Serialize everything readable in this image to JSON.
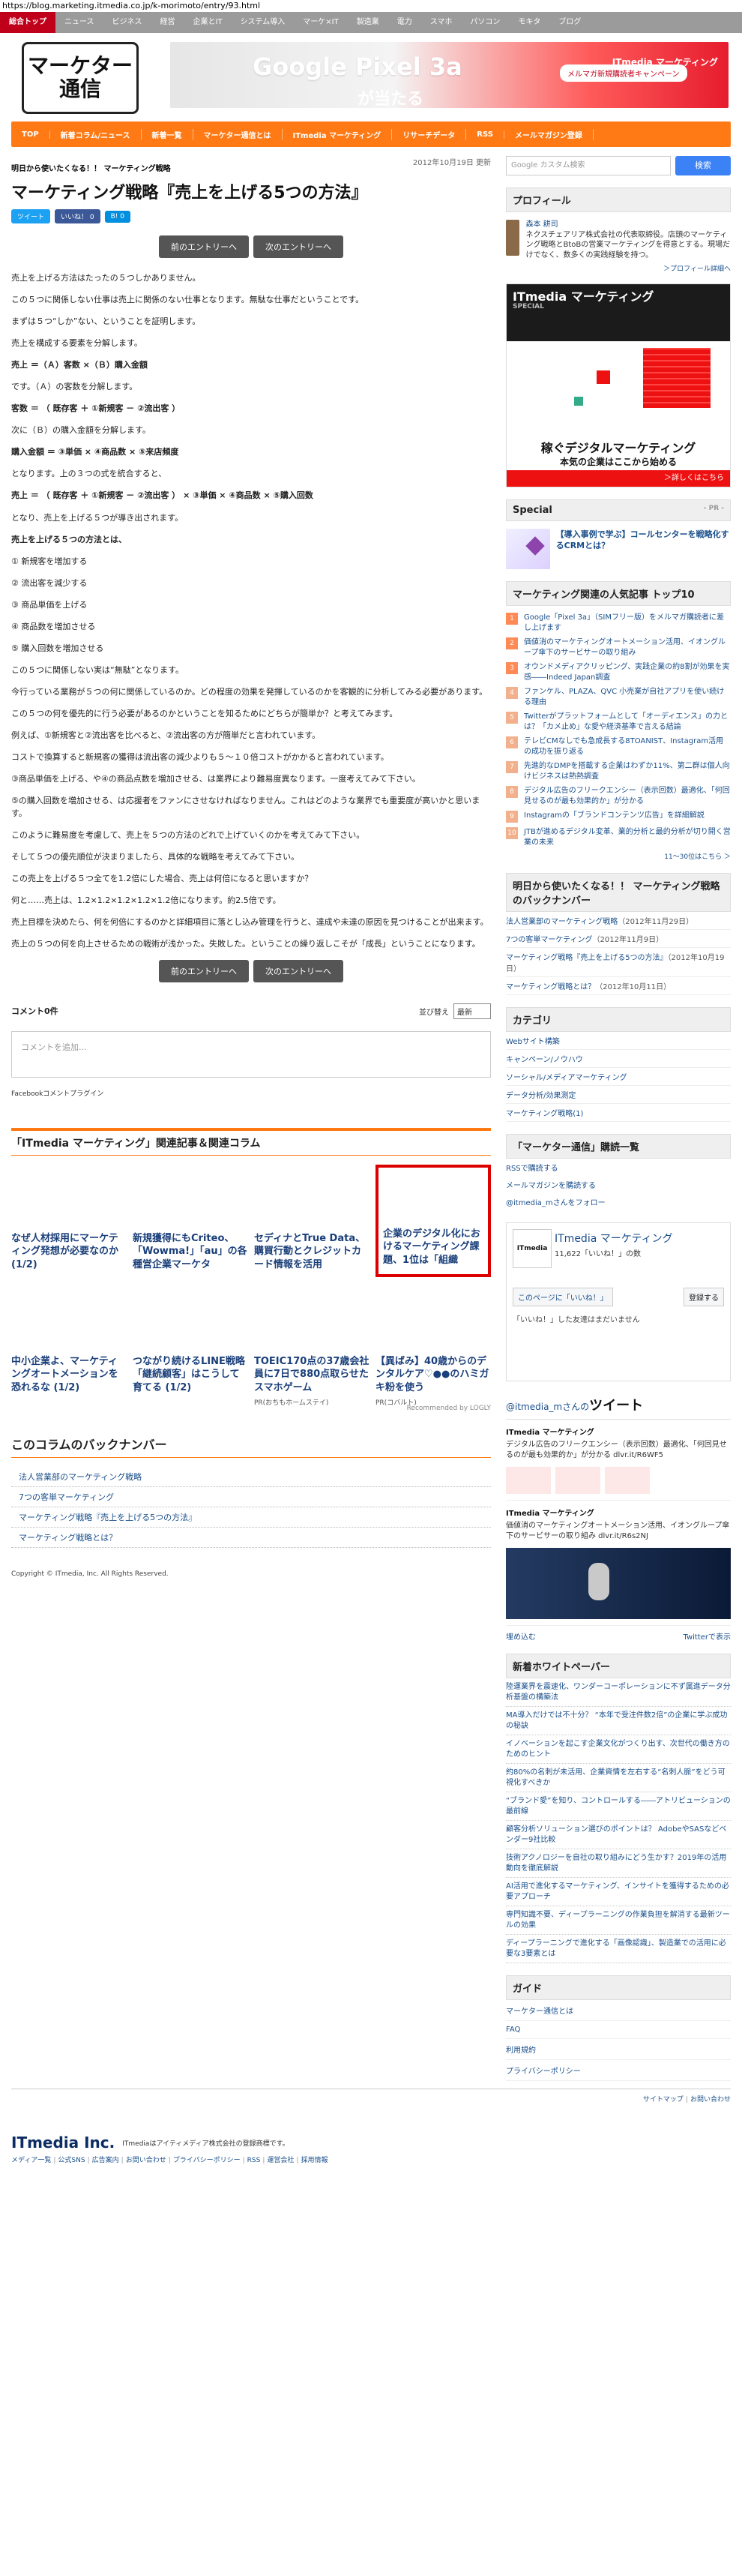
{
  "browser": {
    "url": "https://blog.marketing.itmedia.co.jp/k-morimoto/entry/93.html"
  },
  "topnav": [
    "総合トップ",
    "ニュース",
    "ビジネス",
    "経営",
    "企業とIT",
    "システム導入",
    "マーケ×IT",
    "製造業",
    "電力",
    "スマホ",
    "パソコン",
    "モキタ",
    "ブログ"
  ],
  "header": {
    "logo": "マーケター通信",
    "banner_title": "Google Pixel 3a",
    "banner_sub": "が当たる",
    "banner_pill": "メルマガ新規購読者キャンペーン",
    "banner_brand": "ITmedia マーケティング"
  },
  "orange_nav": [
    "TOP",
    "新着コラム/ニュース",
    "新着一覧",
    "マーケター通信とは",
    "ITmedia マーケティング",
    "リサーチデータ",
    "RSS",
    "メールマガジン登録"
  ],
  "article": {
    "kicker": "明日から使いたくなる！！ マーケティング戦略",
    "date": "2012年10月19日 更新",
    "title": "マーケティング戦略『売上を上げる5つの方法』",
    "tweet": "ツイート",
    "like": "いいね！ 0",
    "hatena": "B! 0",
    "prev": "前のエントリーへ",
    "next": "次のエントリーへ",
    "paragraphs": [
      {
        "text": "売上を上げる方法はたったの５つしかありません。",
        "bold": false
      },
      {
        "text": "この５つに関係しない仕事は売上に関係のない仕事となります。無駄な仕事だということです。",
        "bold": false
      },
      {
        "text": "まずは５つ“しか”ない、ということを証明します。",
        "bold": false
      },
      {
        "text": "売上を構成する要素を分解します。",
        "bold": false
      },
      {
        "text": "売上 ＝（Ａ）客数 ×（Ｂ）購入金額",
        "bold": true
      },
      {
        "text": "です。（Ａ）の客数を分解します。",
        "bold": false
      },
      {
        "text": "客数 ＝ （ 既存客 ＋ ①新規客 － ②流出客 ）",
        "bold": true
      },
      {
        "text": "次に（Ｂ）の購入金額を分解します。",
        "bold": false
      },
      {
        "text": "購入金額 ＝ ③単価 × ④商品数 × ⑤来店頻度",
        "bold": true
      },
      {
        "text": "となります。上の３つの式を統合すると、",
        "bold": false
      },
      {
        "text": "売上 ＝ （ 既存客 ＋ ①新規客 － ②流出客 ） × ③単価 × ④商品数 × ⑤購入回数",
        "bold": true
      },
      {
        "text": "となり、売上を上げる５つが導き出されます。",
        "bold": false
      },
      {
        "text": "売上を上げる５つの方法とは、",
        "bold": true
      },
      {
        "text": "① 新規客を増加する",
        "bold": false
      },
      {
        "text": "② 流出客を減少する",
        "bold": false
      },
      {
        "text": "③ 商品単価を上げる",
        "bold": false
      },
      {
        "text": "④ 商品数を増加させる",
        "bold": false
      },
      {
        "text": "⑤ 購入回数を増加させる",
        "bold": false
      },
      {
        "text": "この５つに関係しない実は“無駄”となります。",
        "bold": false
      },
      {
        "text": "今行っている業務が５つの何に関係しているのか。どの程度の効果を発揮しているのかを客観的に分析してみる必要があります。",
        "bold": false
      },
      {
        "text": "この５つの何を優先的に行う必要があるのかということを知るためにどちらが簡単か？と考えてみます。",
        "bold": false
      },
      {
        "text": "例えば、①新規客と②流出客を比べると、②流出客の方が簡単だと言われています。",
        "bold": false
      },
      {
        "text": "コストで換算すると新規客の獲得は流出客の減少よりも５～１０倍コストがかかると言われています。",
        "bold": false
      },
      {
        "text": "③商品単価を上げる、や④の商品点数を増加させる、は業界により難易度異なります。一度考えてみて下さい。",
        "bold": false
      },
      {
        "text": "⑤の購入回数を増加させる、は応援者をファンにさせなければなりません。これはどのような業界でも重要度が高いかと思います。",
        "bold": false
      },
      {
        "text": "このように難易度を考慮して、売上を５つの方法のどれで上げていくのかを考えてみて下さい。",
        "bold": false
      },
      {
        "text": "そして５つの優先順位が決まりましたら、具体的な戦略を考えてみて下さい。",
        "bold": false
      },
      {
        "text": "この売上を上げる５つ全てを1.2倍にした場合、売上は何倍になると思いますか？",
        "bold": false
      },
      {
        "text": "何と……売上は、1.2×1.2×1.2×1.2×1.2倍になります。約2.5倍です。",
        "bold": false
      },
      {
        "text": "売上目標を決めたら、何を何倍にするのかと詳細項目に落とし込み管理を行うと、達成や未達の原因を見つけることが出来ます。",
        "bold": false
      },
      {
        "text": "売上の５つの何を向上させるための戦術が浅かった。失敗した。ということの繰り返しこそが「成長」ということになります。",
        "bold": false
      }
    ]
  },
  "comments": {
    "label": "コメント0件",
    "sort_label": "並び替え",
    "sort_value": "最新",
    "placeholder": "コメントを追加...",
    "plugin": "Facebookコメントプラグイン"
  },
  "related": {
    "heading": "「ITmedia マーケティング」関連記事＆関連コラム",
    "row1": [
      {
        "title": "なぜ人材採用にマーケティング発想が必要なのか (1/2)",
        "sub": ""
      },
      {
        "title": "新規獲得にもCriteo、「Wowma!」「au」の各種営企業マーケタ",
        "sub": ""
      },
      {
        "title": "セディナとTrue Data、購買行動とクレジットカード情報を活用",
        "sub": ""
      },
      {
        "title": "企業のデジタル化におけるマーケティング課題、1位は「組織",
        "sub": ""
      }
    ],
    "row2": [
      {
        "title": "中小企業よ、マーケティングオートメーションを恐れるな (1/2)",
        "sub": ""
      },
      {
        "title": "つながり続けるLINE戦略「継続顧客」はこうして育てる (1/2)",
        "sub": ""
      },
      {
        "title": "TOEIC170点の37歳会社員に7日で880点取らせたスマホゲーム",
        "sub": "PR(おちもホームステイ)"
      },
      {
        "title": "【異ばみ】40歳からのデンタルケア♡●●のハミガキ粉を使う",
        "sub": "PR(コバルト)"
      }
    ],
    "recommended": "Recommended by LOGLY"
  },
  "backnumber": {
    "heading": "このコラムのバックナンバー",
    "items": [
      "法人営業部のマーケティング戦略",
      "7つの客単マーケティング",
      "マーケティング戦略『売上を上げる5つの方法』",
      "マーケティング戦略とは？"
    ]
  },
  "copyright": "Copyright © ITmedia, Inc. All Rights Reserved.",
  "sidebar": {
    "search_placeholder": "Google カスタム検索",
    "search_button": "検索",
    "profile": {
      "heading": "プロフィール",
      "name": "森本 耕司",
      "text": "ネクスチェアリア株式会社の代表取締役。店頭のマーケティング戦略とBtoBの営業マーケティングを得意とする。現場だけでなく、数多くの実践経験を持つ。",
      "more": "＞プロフィール詳細へ"
    },
    "ad": {
      "pr": "PR",
      "brand": "ITmedia マーケティング",
      "special": "SPECIAL",
      "msg": "稼ぐデジタルマーケティング",
      "msg2": "本気の企業はここから始める",
      "detail": "＞詳しくはこちら"
    },
    "special": {
      "heading": "Special",
      "pr": "- PR -",
      "text": "【導入事例で学ぶ】コールセンターを戦略化するCRMとは？"
    },
    "ranking": {
      "heading": "マーケティング関連の人気記事 トップ10",
      "items": [
        "Google「Pixel 3a」（SIMフリー版）をメルマガ購読者に差し上げます",
        "価値消のマーケティングオートメーション活用、イオングループ傘下のサービサーの取り組み",
        "オウンドメディアクリッピング、実践企業の約8割が効果を実感――Indeed Japan調査",
        "ファンケル、PLAZA、QVC 小売業が自社アプリを使い続ける理由",
        "Twitterがプラットフォームとして「オーディエンス」の力とは？「カメ止め」な愛や経済基準で言える結論",
        "テレビCMなしでも急成長する8TOANIST、Instagram活用の成功を振り返る",
        "先進的なDMPを搭載する企業はわずか11%、第二群は個人向けビジネスは熱熱調査",
        "デジタル広告のフリークエンシー（表示回数）最適化、「何回見せるのが最も効果的か」が分かる",
        "Instagramの「ブランドコンテンツ広告」を詳細解説",
        "JTBが進めるデジタル変革、業的分析と最的分析が切り開く営業の未来"
      ],
      "all": "11～30位はこちら ＞"
    },
    "backnumber": {
      "heading": "明日から使いたくなる！！ マーケティング戦略のバックナンバー",
      "items": [
        {
          "t": "法人営業部のマーケティング戦略",
          "d": "（2012年11月29日）"
        },
        {
          "t": "7つの客単マーケティング",
          "d": "（2012年11月9日）"
        },
        {
          "t": "マーケティング戦略『売上を上げる5つの方法』",
          "d": "（2012年10月19日）"
        },
        {
          "t": "マーケティング戦略とは？",
          "d": "（2012年10月11日）"
        }
      ]
    },
    "categories": {
      "heading": "カテゴリ",
      "items": [
        "Webサイト構築",
        "キャンペーン/ノウハウ",
        "ソーシャル/メディアマーケティング",
        "データ分析/効果測定",
        "マーケティング戦略(1)"
      ]
    },
    "mail": {
      "heading": "「マーケター通信」購読一覧",
      "items": [
        "RSSで購読する",
        "メールマガジンを購読する",
        "@itmedia_mさんをフォロー"
      ]
    },
    "facebook": {
      "logo": "ITmedia",
      "title": "ITmedia マーケティング",
      "count": "11,622「いいね！」の数",
      "page": "このページに「いいね！」",
      "share": "登録する",
      "nofriend": "「いいね！」した友達はまだいません"
    },
    "twitter": {
      "by": "@itmedia_mさんの",
      "heading": "ツイート",
      "tweets": [
        {
          "who": "ITmedia マーケティング",
          "body": "デジタル広告のフリークエンシー（表示回数）最適化、「何回見せるのが最も効果的か」が分かる dlvr.it/R6WF5"
        },
        {
          "who": "ITmedia マーケティング",
          "body": "価値消のマーケティングオートメーション活用、イオングループ傘下のサービサーの取り組み dlvr.it/R6s2NJ"
        }
      ],
      "embed": "埋め込む",
      "view": "Twitterで表示"
    },
    "whitepaper": {
      "heading": "新着ホワイトペーパー",
      "items": [
        "陸運業界を震速化、ワンダーコーポレーションに不ず属進データ分析基盤の構築法",
        "MA導入だけでは不十分？ “本年で受注件数2倍”の企業に学ぶ成功の秘訣",
        "イノベーションを起こす企業文化がつくり出す、次世代の働き方のためのヒント",
        "約80%の名刺が未活用、企業資情を左右する“名刺人脈”をどう可視化すべきか",
        "“ブランド愛”を知り、コントロールする――アトリビューションの最前線",
        "顧客分析ソリューション選びのポイントは？ AdobeやSASなどベンダー9社比較",
        "技術アクノロジーを自社の取り組みにどう生かす？2019年の活用動向を徹底解説",
        "AI活用で進化するマーケティング、インサイトを獲得するための必要アプローチ",
        "専門知識不要、ディープラーニングの作業負担を解消する最新ツールの効果",
        "ディープラーニングで進化する「画像認識」、製造業での活用に必要な3要素とは"
      ]
    },
    "guide": {
      "heading": "ガイド",
      "items": [
        "マーケター通信とは",
        "FAQ",
        "利用規約",
        "プライバシーポリシー"
      ]
    }
  },
  "footer": {
    "sitemap": "サイトマップ",
    "inquiry": "お問い合わせ",
    "logo": "ITmedia Inc.",
    "trademark": "ITmediaはアイティメディア株式会社の登録商標です。",
    "links": [
      "メディア一覧",
      "公式SNS",
      "広告案内",
      "お問い合わせ",
      "プライバシーポリシー",
      "RSS",
      "運営会社",
      "採用情報"
    ]
  }
}
